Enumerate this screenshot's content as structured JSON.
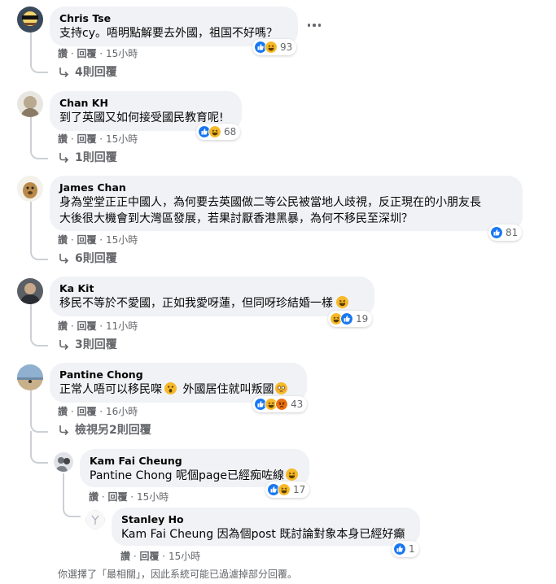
{
  "comments": [
    {
      "author": "Chris Tse",
      "text": "支持cy。唔明點解要去外國，祖国不好嗎？",
      "like": "讚",
      "reply": "回覆",
      "time": "15小時",
      "reactions": "93",
      "replies_link": "4則回覆"
    },
    {
      "author": "Chan KH",
      "text": "到了英國又如何接受國民教育呢!",
      "like": "讚",
      "reply": "回覆",
      "time": "15小時",
      "reactions": "68",
      "replies_link": "1則回覆"
    },
    {
      "author": "James Chan",
      "text_line1": "身為堂堂正正中國人，為何要去英國做二等公民被當地人歧視，反正現在的小朋友長",
      "text_line2": "大後很大機會到大灣區發展，若果討厭香港黑暴，為何不移民至深圳？",
      "like": "讚",
      "reply": "回覆",
      "time": "15小時",
      "reactions": "81",
      "replies_link": "6則回覆"
    },
    {
      "author": "Ka Kit",
      "text": "移民不等於不愛國，正如我愛呀蓮，但同呀珍結婚一樣",
      "like": "讚",
      "reply": "回覆",
      "time": "11小時",
      "reactions": "19",
      "replies_link": "3則回覆"
    },
    {
      "author": "Pantine Chong",
      "text_a": "正常人唔可以移民㗎",
      "text_b": "外國居住就叫叛國",
      "like": "讚",
      "reply": "回覆",
      "time": "16小時",
      "reactions": "43",
      "replies_link": "檢視另2則回覆"
    }
  ],
  "replies": [
    {
      "author": "Kam Fai Cheung",
      "tag": "Pantine Chong",
      "text": "呢個page已經痴咗線",
      "like": "讚",
      "reply": "回覆",
      "time": "15小時",
      "reactions": "17"
    },
    {
      "author": "Stanley Ho",
      "tag": "Kam Fai Cheung",
      "text": "因為個post 既討論對象本身已經好癲",
      "like": "讚",
      "reply": "回覆",
      "time": "15小時",
      "reactions": "1"
    }
  ],
  "footer_note": "你選擇了「最相關」，因此系統可能已過濾掉部分回覆。",
  "colors": {
    "like_blue": "#1877f2",
    "haha_yellow": "#f7b928",
    "angry_orange": "#e9710f",
    "muted_text": "#65676b",
    "bubble_bg": "#f0f2f5"
  }
}
